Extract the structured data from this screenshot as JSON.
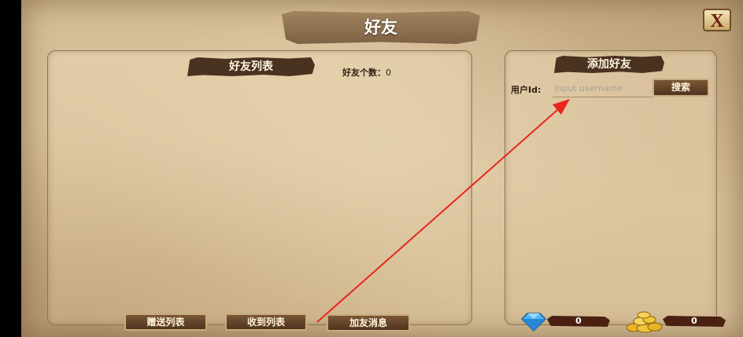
{
  "title": "好友",
  "close_label": "X",
  "friends_panel": {
    "header": "好友列表",
    "count_label": "好友个数：",
    "count_value": "0"
  },
  "add_panel": {
    "header": "添加好友",
    "user_id_label": "用户Id:",
    "input_placeholder": "Input username",
    "input_value": "",
    "search_label": "搜索"
  },
  "bottom_buttons": {
    "gift_list": "赠送列表",
    "received_list": "收到列表",
    "friend_requests": "加友消息"
  },
  "currency": {
    "gems": "0",
    "gold": "0"
  },
  "colors": {
    "parchment": "#d6bf98",
    "banner": "#4a3220",
    "button": "#5e3f26",
    "arrow": "#e8261c"
  }
}
